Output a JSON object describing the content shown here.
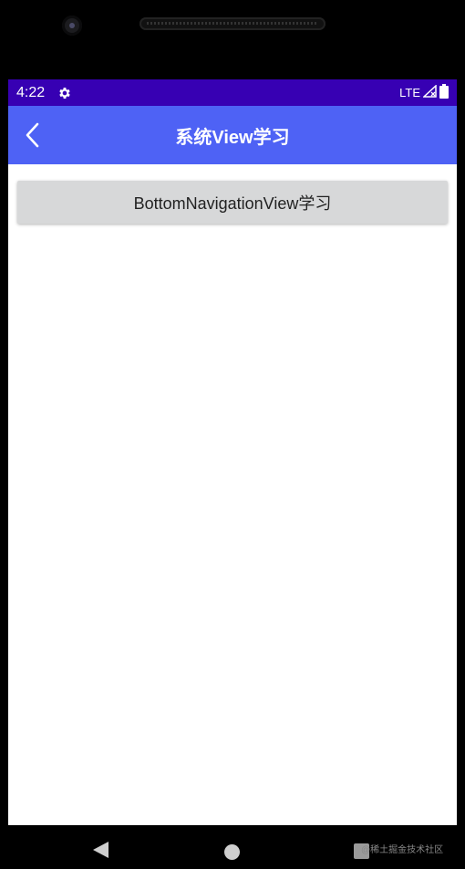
{
  "status_bar": {
    "time": "4:22",
    "settings_icon": "gear-icon",
    "network": "LTE",
    "signal_icon": "signal-icon",
    "battery_icon": "battery-icon",
    "background_color": "#3700b3"
  },
  "toolbar": {
    "back_icon": "chevron-left-icon",
    "title": "系统View学习",
    "background_color": "#4e62f5"
  },
  "main": {
    "button_label": "BottomNavigationView学习"
  },
  "nav_bar": {
    "back_icon": "triangle-back-icon",
    "home_icon": "circle-home-icon",
    "recents_icon": "square-recents-icon",
    "watermark": "@稀土掘金技术社区"
  }
}
